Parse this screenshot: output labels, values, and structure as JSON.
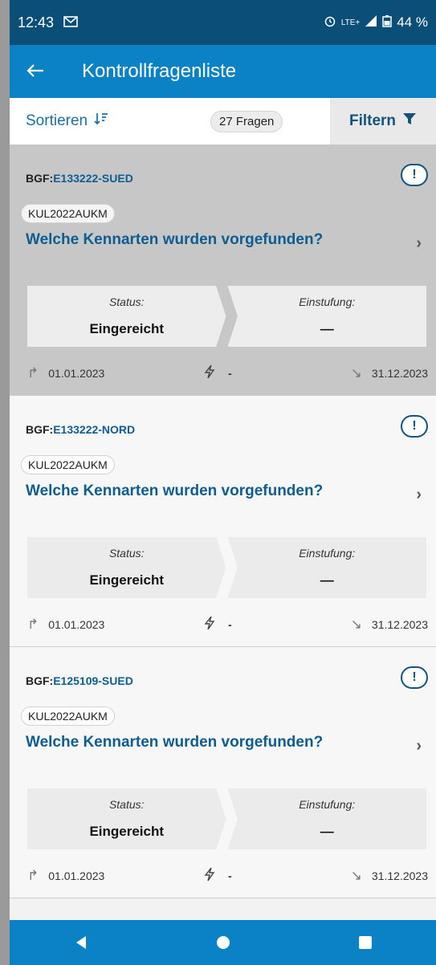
{
  "status_bar": {
    "time": "12:43",
    "network": "LTE+",
    "battery": "44 %"
  },
  "app_bar": {
    "title": "Kontrollfragenliste"
  },
  "toolbar": {
    "sort_label": "Sortieren",
    "count_label": "27 Fragen",
    "filter_label": "Filtern"
  },
  "cards": [
    {
      "bgf_prefix": "BGF:",
      "bgf_id": "E133222-SUED",
      "tag": "KUL2022AUKM",
      "question": "Welche Kennarten wurden vorgefunden?",
      "status_label": "Status:",
      "status_value": "Eingereicht",
      "rating_label": "Einstufung:",
      "rating_value": "—",
      "start_date": "01.01.2023",
      "middle_value": "-",
      "end_date": "31.12.2023"
    },
    {
      "bgf_prefix": "BGF:",
      "bgf_id": "E133222-NORD",
      "tag": "KUL2022AUKM",
      "question": "Welche Kennarten wurden vorgefunden?",
      "status_label": "Status:",
      "status_value": "Eingereicht",
      "rating_label": "Einstufung:",
      "rating_value": "—",
      "start_date": "01.01.2023",
      "middle_value": "-",
      "end_date": "31.12.2023"
    },
    {
      "bgf_prefix": "BGF:",
      "bgf_id": "E125109-SUED",
      "tag": "KUL2022AUKM",
      "question": "Welche Kennarten wurden vorgefunden?",
      "status_label": "Status:",
      "status_value": "Eingereicht",
      "rating_label": "Einstufung:",
      "rating_value": "—",
      "start_date": "01.01.2023",
      "middle_value": "-",
      "end_date": "31.12.2023"
    }
  ],
  "colors": {
    "primary": "#0a82c5",
    "status_bar": "#0b4f78",
    "accent_text": "#0e5d91"
  },
  "icons": {
    "back": "arrow-left-icon",
    "sort": "sort-icon",
    "filter": "funnel-icon",
    "alert": "exclamation-icon",
    "chevron": "chevron-right-icon"
  }
}
